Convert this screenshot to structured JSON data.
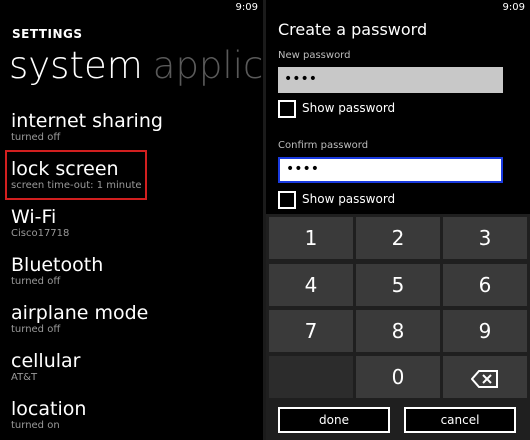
{
  "status_time": "9:09",
  "settings": {
    "header": "SETTINGS",
    "pivot_active": "system",
    "pivot_inactive": "applicat",
    "items": [
      {
        "title": "internet sharing",
        "sub": "turned off"
      },
      {
        "title": "lock screen",
        "sub": "screen time-out: 1 minute"
      },
      {
        "title": "Wi-Fi",
        "sub": "Cisco17718"
      },
      {
        "title": "Bluetooth",
        "sub": "turned off"
      },
      {
        "title": "airplane mode",
        "sub": "turned off"
      },
      {
        "title": "cellular",
        "sub": "AT&T"
      },
      {
        "title": "location",
        "sub": "turned on"
      }
    ],
    "highlight_color": "#d21f1f"
  },
  "password_dialog": {
    "title": "Create a password",
    "new_password_label": "New password",
    "new_password_value": "••••",
    "show_password_label": "Show password",
    "confirm_password_label": "Confirm password",
    "confirm_password_value": "••••",
    "focus_color": "#1a3be0"
  },
  "keypad": {
    "keys": [
      "1",
      "2",
      "3",
      "4",
      "5",
      "6",
      "7",
      "8",
      "9",
      "",
      "0",
      "⌫"
    ],
    "backspace_icon": "backspace-icon"
  },
  "appbar": {
    "done_label": "done",
    "cancel_label": "cancel"
  }
}
